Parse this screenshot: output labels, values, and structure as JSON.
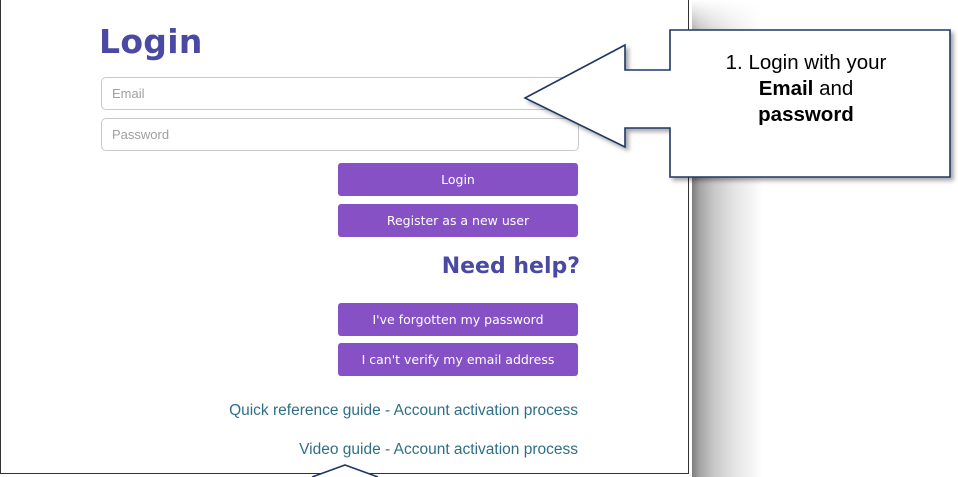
{
  "login_form": {
    "title": "Login",
    "email_placeholder": "Email",
    "password_placeholder": "Password",
    "login_button": "Login",
    "register_button": "Register as a new user"
  },
  "help": {
    "heading": "Need help?",
    "forgot_password_button": "I've forgotten my password",
    "verify_email_button": "I can't verify my email address"
  },
  "links": {
    "quick_reference": "Quick reference guide - Account activation process",
    "video_guide": "Video guide - Account activation process"
  },
  "callout": {
    "step_text_prefix": "1. Login with your",
    "bold_email": "Email",
    "and": "and",
    "bold_password": "password"
  },
  "colors": {
    "brand_heading": "#4a4aa5",
    "button_purple": "#8551c4",
    "link_teal": "#2f6f86",
    "callout_border": "#1f3864"
  }
}
